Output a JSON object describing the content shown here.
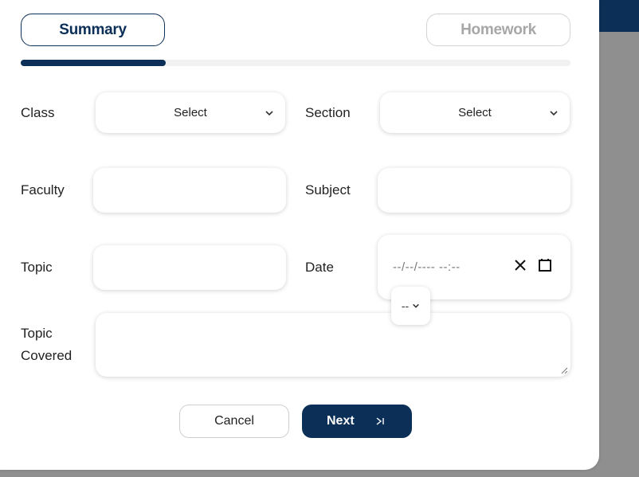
{
  "tabs": {
    "summary_label": "Summary",
    "homework_label": "Homework",
    "progress_fraction": 0.264
  },
  "form": {
    "class_label": "Class",
    "class_value": "Select",
    "section_label": "Section",
    "section_value": "Select",
    "faculty_label": "Faculty",
    "faculty_value": "",
    "subject_label": "Subject",
    "subject_value": "",
    "topic_label": "Topic",
    "topic_value": "",
    "date_label": "Date",
    "date_placeholder": "--/--/---- --:--",
    "ampm_value": "--",
    "topic_covered_label_line1": "Topic",
    "topic_covered_label_line2": "Covered",
    "topic_covered_value": ""
  },
  "actions": {
    "cancel_label": "Cancel",
    "next_label": "Next"
  },
  "icons": {
    "select_chevron": "chevron-down-icon",
    "date_clear": "close-icon",
    "date_picker": "calendar-icon",
    "next": "skip-next-icon"
  },
  "colors": {
    "primary": "#0b2f57",
    "tab_inactive_text": "#a7a7a7",
    "progress_track": "#f1f1f1",
    "overlay": "#8f8f8f"
  }
}
